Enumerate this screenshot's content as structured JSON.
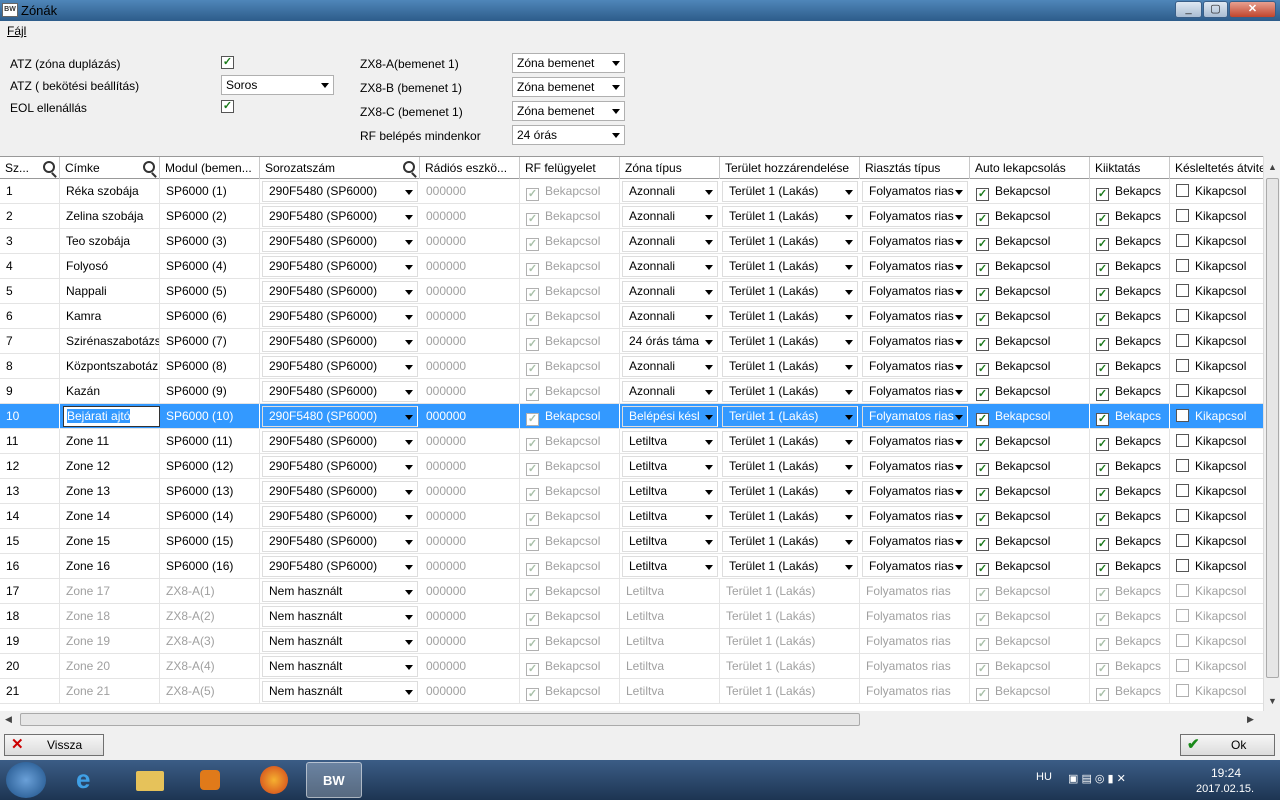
{
  "window": {
    "title": "Zónák",
    "app_icon": "BW"
  },
  "menu": {
    "file": "Fájl"
  },
  "settings": {
    "atz_dup_label": "ATZ (zóna duplázás)",
    "atz_wiring_label": "ATZ ( bekötési beállítás)",
    "atz_wiring_value": "Soros",
    "eol_label": "EOL ellenállás",
    "zx8a_label": "ZX8-A(bemenet 1)",
    "zx8a_value": "Zóna bemenet",
    "zx8b_label": "ZX8-B (bemenet 1)",
    "zx8b_value": "Zóna bemenet",
    "zx8c_label": "ZX8-C (bemenet 1)",
    "zx8c_value": "Zóna bemenet",
    "rf_label": "RF belépés mindenkor",
    "rf_value": "24 órás"
  },
  "columns": [
    "Sz...",
    "Címke",
    "Modul (bemen...",
    "Sorozatszám",
    "Rádiós eszkö...",
    "RF felügyelet",
    "Zóna típus",
    "Terület hozzárendelése",
    "Riasztás típus",
    "Auto lekapcsolás",
    "Kiiktatás",
    "Késleltetés átvitel"
  ],
  "rows": [
    {
      "n": "1",
      "label": "Réka szobája",
      "module": "SP6000  (1)",
      "serial": "290F5480 (SP6000)",
      "radio": "000000",
      "rf": "Bekapcsol",
      "type": "Azonnali",
      "area": "Terület 1 (Lakás)",
      "alarm": "Folyamatos rias",
      "auto": "Bekapcsol",
      "bypass": "Bekapcs",
      "delay": "Kikapcsol"
    },
    {
      "n": "2",
      "label": "Zelina szobája",
      "module": "SP6000  (2)",
      "serial": "290F5480 (SP6000)",
      "radio": "000000",
      "rf": "Bekapcsol",
      "type": "Azonnali",
      "area": "Terület 1 (Lakás)",
      "alarm": "Folyamatos rias",
      "auto": "Bekapcsol",
      "bypass": "Bekapcs",
      "delay": "Kikapcsol"
    },
    {
      "n": "3",
      "label": "Teo szobája",
      "module": "SP6000  (3)",
      "serial": "290F5480 (SP6000)",
      "radio": "000000",
      "rf": "Bekapcsol",
      "type": "Azonnali",
      "area": "Terület 1 (Lakás)",
      "alarm": "Folyamatos rias",
      "auto": "Bekapcsol",
      "bypass": "Bekapcs",
      "delay": "Kikapcsol"
    },
    {
      "n": "4",
      "label": "Folyosó",
      "module": "SP6000  (4)",
      "serial": "290F5480 (SP6000)",
      "radio": "000000",
      "rf": "Bekapcsol",
      "type": "Azonnali",
      "area": "Terület 1 (Lakás)",
      "alarm": "Folyamatos rias",
      "auto": "Bekapcsol",
      "bypass": "Bekapcs",
      "delay": "Kikapcsol"
    },
    {
      "n": "5",
      "label": "Nappali",
      "module": "SP6000  (5)",
      "serial": "290F5480 (SP6000)",
      "radio": "000000",
      "rf": "Bekapcsol",
      "type": "Azonnali",
      "area": "Terület 1 (Lakás)",
      "alarm": "Folyamatos rias",
      "auto": "Bekapcsol",
      "bypass": "Bekapcs",
      "delay": "Kikapcsol"
    },
    {
      "n": "6",
      "label": "Kamra",
      "module": "SP6000  (6)",
      "serial": "290F5480 (SP6000)",
      "radio": "000000",
      "rf": "Bekapcsol",
      "type": "Azonnali",
      "area": "Terület 1 (Lakás)",
      "alarm": "Folyamatos rias",
      "auto": "Bekapcsol",
      "bypass": "Bekapcs",
      "delay": "Kikapcsol"
    },
    {
      "n": "7",
      "label": "Szirénaszabotázs",
      "module": "SP6000  (7)",
      "serial": "290F5480 (SP6000)",
      "radio": "000000",
      "rf": "Bekapcsol",
      "type": "24 órás táma",
      "area": "Terület 1 (Lakás)",
      "alarm": "Folyamatos rias",
      "auto": "Bekapcsol",
      "bypass": "Bekapcs",
      "delay": "Kikapcsol"
    },
    {
      "n": "8",
      "label": "Központszabotáz",
      "module": "SP6000  (8)",
      "serial": "290F5480 (SP6000)",
      "radio": "000000",
      "rf": "Bekapcsol",
      "type": "Azonnali",
      "area": "Terület 1 (Lakás)",
      "alarm": "Folyamatos rias",
      "auto": "Bekapcsol",
      "bypass": "Bekapcs",
      "delay": "Kikapcsol"
    },
    {
      "n": "9",
      "label": "Kazán",
      "module": "SP6000  (9)",
      "serial": "290F5480 (SP6000)",
      "radio": "000000",
      "rf": "Bekapcsol",
      "type": "Azonnali",
      "area": "Terület 1 (Lakás)",
      "alarm": "Folyamatos rias",
      "auto": "Bekapcsol",
      "bypass": "Bekapcs",
      "delay": "Kikapcsol"
    },
    {
      "n": "10",
      "label": "Bejárati ajtó",
      "module": "SP6000  (10)",
      "serial": "290F5480 (SP6000)",
      "radio": "000000",
      "rf": "Bekapcsol",
      "type": "Belépési késl",
      "area": "Terület 1 (Lakás)",
      "alarm": "Folyamatos rias",
      "auto": "Bekapcsol",
      "bypass": "Bekapcs",
      "delay": "Kikapcsol"
    },
    {
      "n": "11",
      "label": "Zone 11",
      "module": "SP6000  (11)",
      "serial": "290F5480 (SP6000)",
      "radio": "000000",
      "rf": "Bekapcsol",
      "type": "Letiltva",
      "area": "Terület 1 (Lakás)",
      "alarm": "Folyamatos rias",
      "auto": "Bekapcsol",
      "bypass": "Bekapcs",
      "delay": "Kikapcsol"
    },
    {
      "n": "12",
      "label": "Zone 12",
      "module": "SP6000  (12)",
      "serial": "290F5480 (SP6000)",
      "radio": "000000",
      "rf": "Bekapcsol",
      "type": "Letiltva",
      "area": "Terület 1 (Lakás)",
      "alarm": "Folyamatos rias",
      "auto": "Bekapcsol",
      "bypass": "Bekapcs",
      "delay": "Kikapcsol"
    },
    {
      "n": "13",
      "label": "Zone 13",
      "module": "SP6000  (13)",
      "serial": "290F5480 (SP6000)",
      "radio": "000000",
      "rf": "Bekapcsol",
      "type": "Letiltva",
      "area": "Terület 1 (Lakás)",
      "alarm": "Folyamatos rias",
      "auto": "Bekapcsol",
      "bypass": "Bekapcs",
      "delay": "Kikapcsol"
    },
    {
      "n": "14",
      "label": "Zone 14",
      "module": "SP6000  (14)",
      "serial": "290F5480 (SP6000)",
      "radio": "000000",
      "rf": "Bekapcsol",
      "type": "Letiltva",
      "area": "Terület 1 (Lakás)",
      "alarm": "Folyamatos rias",
      "auto": "Bekapcsol",
      "bypass": "Bekapcs",
      "delay": "Kikapcsol"
    },
    {
      "n": "15",
      "label": "Zone 15",
      "module": "SP6000  (15)",
      "serial": "290F5480 (SP6000)",
      "radio": "000000",
      "rf": "Bekapcsol",
      "type": "Letiltva",
      "area": "Terület 1 (Lakás)",
      "alarm": "Folyamatos rias",
      "auto": "Bekapcsol",
      "bypass": "Bekapcs",
      "delay": "Kikapcsol"
    },
    {
      "n": "16",
      "label": "Zone 16",
      "module": "SP6000  (16)",
      "serial": "290F5480 (SP6000)",
      "radio": "000000",
      "rf": "Bekapcsol",
      "type": "Letiltva",
      "area": "Terület 1 (Lakás)",
      "alarm": "Folyamatos rias",
      "auto": "Bekapcsol",
      "bypass": "Bekapcs",
      "delay": "Kikapcsol"
    },
    {
      "n": "17",
      "label": "Zone 17",
      "module": "ZX8-A(1)",
      "serial": "Nem használt",
      "radio": "000000",
      "rf": "Bekapcsol",
      "type": "Letiltva",
      "area": "Terület 1 (Lakás)",
      "alarm": "Folyamatos rias",
      "auto": "Bekapcsol",
      "bypass": "Bekapcs",
      "delay": "Kikapcsol"
    },
    {
      "n": "18",
      "label": "Zone 18",
      "module": "ZX8-A(2)",
      "serial": "Nem használt",
      "radio": "000000",
      "rf": "Bekapcsol",
      "type": "Letiltva",
      "area": "Terület 1 (Lakás)",
      "alarm": "Folyamatos rias",
      "auto": "Bekapcsol",
      "bypass": "Bekapcs",
      "delay": "Kikapcsol"
    },
    {
      "n": "19",
      "label": "Zone 19",
      "module": "ZX8-A(3)",
      "serial": "Nem használt",
      "radio": "000000",
      "rf": "Bekapcsol",
      "type": "Letiltva",
      "area": "Terület 1 (Lakás)",
      "alarm": "Folyamatos rias",
      "auto": "Bekapcsol",
      "bypass": "Bekapcs",
      "delay": "Kikapcsol"
    },
    {
      "n": "20",
      "label": "Zone 20",
      "module": "ZX8-A(4)",
      "serial": "Nem használt",
      "radio": "000000",
      "rf": "Bekapcsol",
      "type": "Letiltva",
      "area": "Terület 1 (Lakás)",
      "alarm": "Folyamatos rias",
      "auto": "Bekapcsol",
      "bypass": "Bekapcs",
      "delay": "Kikapcsol"
    },
    {
      "n": "21",
      "label": "Zone 21",
      "module": "ZX8-A(5)",
      "serial": "Nem használt",
      "radio": "000000",
      "rf": "Bekapcsol",
      "type": "Letiltva",
      "area": "Terület 1 (Lakás)",
      "alarm": "Folyamatos rias",
      "auto": "Bekapcsol",
      "bypass": "Bekapcs",
      "delay": "Kikapcsol"
    }
  ],
  "footer": {
    "back": "Vissza",
    "ok": "Ok"
  },
  "taskbar": {
    "lang": "HU",
    "time": "19:24",
    "date": "2017.02.15."
  },
  "colors": {
    "selection": "#3399ff",
    "check": "#1a7a1a"
  }
}
